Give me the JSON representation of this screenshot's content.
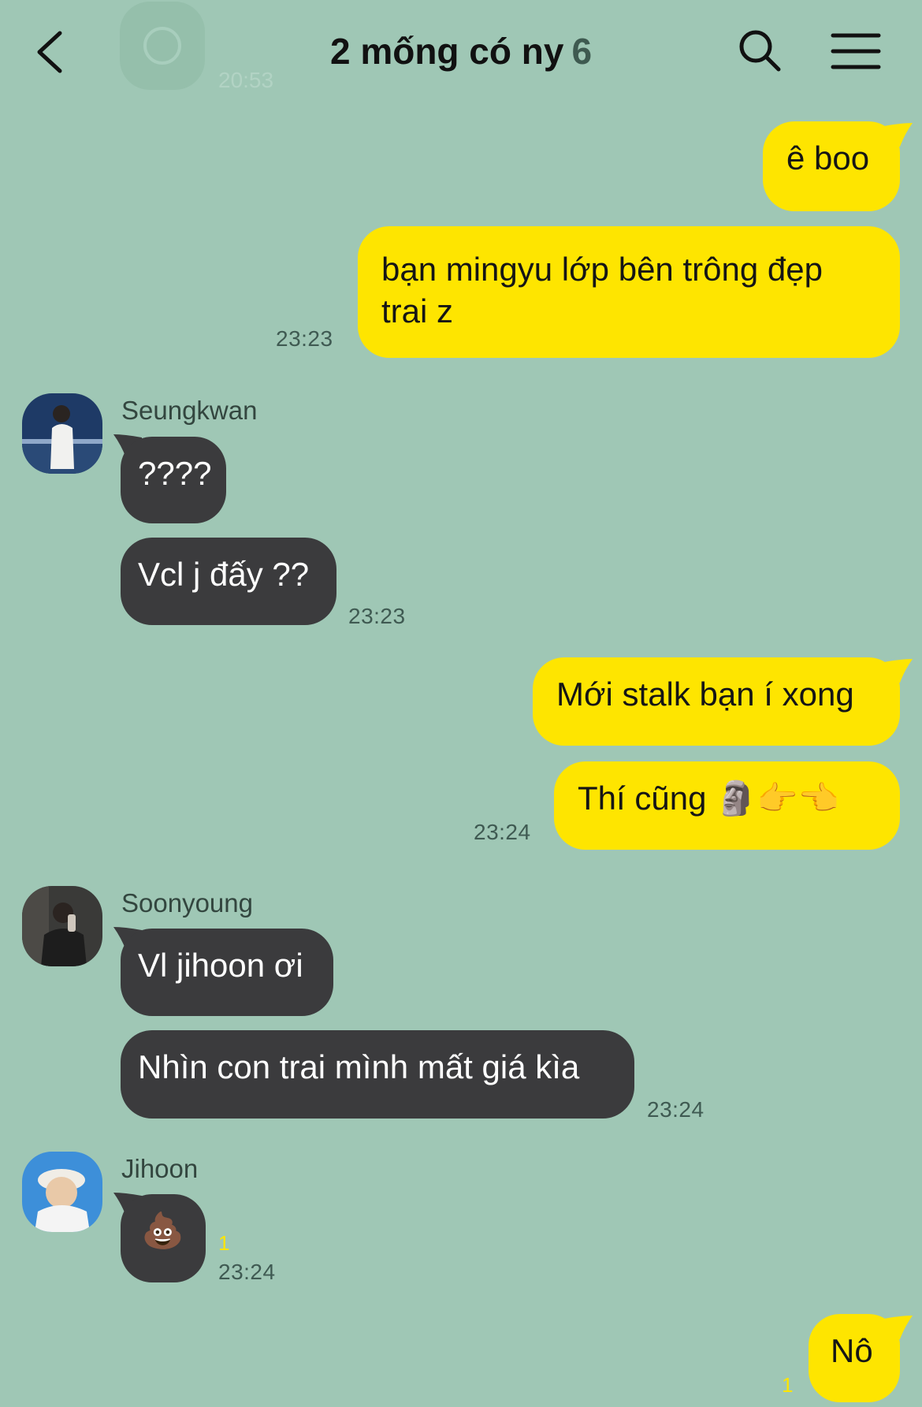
{
  "header": {
    "title": "2 mống có ny",
    "member_count": "6",
    "faded_time": "20:53",
    "back_icon": "chevron-left-icon",
    "search_icon": "search-icon",
    "menu_icon": "hamburger-menu-icon"
  },
  "colors": {
    "background": "#9fc7b5",
    "my_bubble": "#fee500",
    "their_bubble": "#3b3b3d",
    "time_text": "#3f5a52",
    "unread": "#fee500"
  },
  "messages": [
    {
      "from": "me",
      "text": "ê boo"
    },
    {
      "from": "me",
      "text": "bạn mingyu lớp bên trông đẹp trai z",
      "line1": "bạn mingyu lớp bên trông đẹp",
      "line2": "trai z",
      "time": "23:23"
    },
    {
      "from": "Seungkwan",
      "text": "????"
    },
    {
      "from": "Seungkwan",
      "text": "Vcl j đấy ??",
      "time": "23:23"
    },
    {
      "from": "me",
      "text": "Mới stalk bạn í xong"
    },
    {
      "from": "me",
      "text": "Thí cũng 🗿👉👈",
      "time": "23:24"
    },
    {
      "from": "Soonyoung",
      "text": "Vl jihoon ơi"
    },
    {
      "from": "Soonyoung",
      "text": "Nhìn con trai mình mất giá kìa",
      "time": "23:24"
    },
    {
      "from": "Jihoon",
      "text": "💩",
      "unread": "1",
      "time": "23:24"
    },
    {
      "from": "me",
      "text": "Nô",
      "unread": "1"
    }
  ],
  "senders": {
    "seungkwan": "Seungkwan",
    "soonyoung": "Soonyoung",
    "jihoon": "Jihoon"
  }
}
